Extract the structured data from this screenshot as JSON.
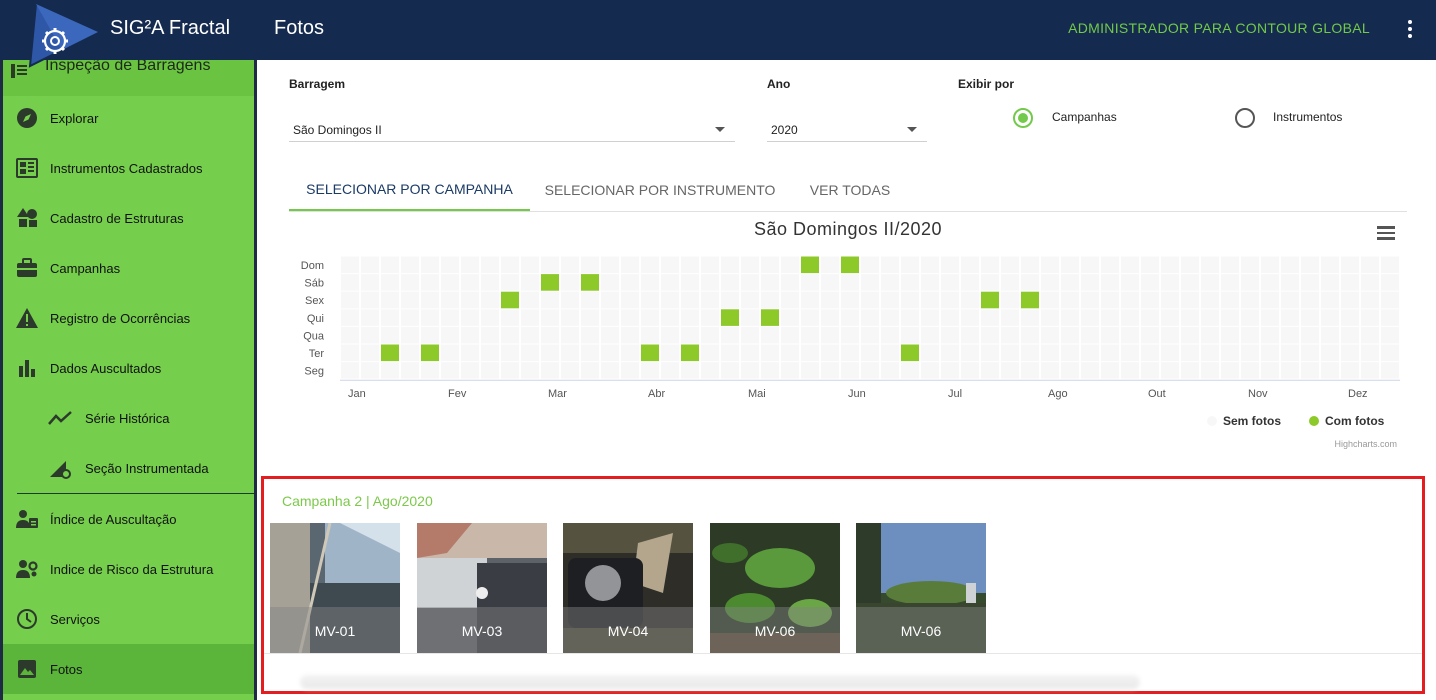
{
  "header": {
    "brand": "SIG²A Fractal",
    "page_title": "Fotos",
    "user": "ADMINISTRADOR PARA CONTOUR GLOBAL"
  },
  "sidebar": {
    "section": "Inspeção de Barragens",
    "items": [
      {
        "label": "Explorar",
        "icon": "compass-icon"
      },
      {
        "label": "Instrumentos Cadastrados",
        "icon": "dashboard-icon"
      },
      {
        "label": "Cadastro de Estruturas",
        "icon": "shapes-icon"
      },
      {
        "label": "Campanhas",
        "icon": "briefcase-icon"
      },
      {
        "label": "Registro de Ocorrências",
        "icon": "warning-icon"
      },
      {
        "label": "Dados Auscultados",
        "icon": "bar-chart-icon"
      },
      {
        "label": "Série Histórica",
        "icon": "trend-icon"
      },
      {
        "label": "Seção Instrumentada",
        "icon": "section-icon"
      },
      {
        "label": "Índice de Auscultação",
        "icon": "person-badge-icon"
      },
      {
        "label": "Indice de Risco da Estrutura",
        "icon": "person-gear-icon"
      },
      {
        "label": "Serviços",
        "icon": "clock-icon"
      },
      {
        "label": "Fotos",
        "icon": "image-icon"
      }
    ]
  },
  "filters": {
    "barragem_label": "Barragem",
    "barragem_value": "São Domingos II",
    "ano_label": "Ano",
    "ano_value": "2020",
    "exibir_label": "Exibir por",
    "options": [
      "Campanhas",
      "Instrumentos"
    ],
    "selected": "Campanhas"
  },
  "tabs": [
    "SELECIONAR POR CAMPANHA",
    "SELECIONAR POR INSTRUMENTO",
    "VER TODAS"
  ],
  "chart_data": {
    "type": "heatmap",
    "title": "São Domingos II/2020",
    "y_categories": [
      "Dom",
      "Sáb",
      "Sex",
      "Qui",
      "Qua",
      "Ter",
      "Seg"
    ],
    "x_labels": [
      "Jan",
      "Fev",
      "Mar",
      "Abr",
      "Mai",
      "Jun",
      "Jul",
      "Ago",
      "Out",
      "Nov",
      "Dez"
    ],
    "legend": [
      "Sem fotos",
      "Com fotos"
    ],
    "colors": {
      "with": "#8cc929",
      "without": "#f7f7f7"
    },
    "credits": "Highcharts.com",
    "points": [
      {
        "week": 2,
        "day": "Ter"
      },
      {
        "week": 4,
        "day": "Ter"
      },
      {
        "week": 8,
        "day": "Sex"
      },
      {
        "week": 10,
        "day": "Sáb"
      },
      {
        "week": 12,
        "day": "Sáb"
      },
      {
        "week": 15,
        "day": "Ter"
      },
      {
        "week": 17,
        "day": "Ter"
      },
      {
        "week": 19,
        "day": "Qui"
      },
      {
        "week": 21,
        "day": "Qui"
      },
      {
        "week": 23,
        "day": "Dom"
      },
      {
        "week": 25,
        "day": "Dom"
      },
      {
        "week": 28,
        "day": "Ter"
      },
      {
        "week": 32,
        "day": "Sex"
      },
      {
        "week": 34,
        "day": "Sex"
      }
    ]
  },
  "campaign": {
    "title": "Campanha 2 | Ago/2020",
    "photos": [
      {
        "label": "MV-01"
      },
      {
        "label": "MV-03"
      },
      {
        "label": "MV-04"
      },
      {
        "label": "MV-06"
      },
      {
        "label": "MV-06"
      }
    ]
  }
}
